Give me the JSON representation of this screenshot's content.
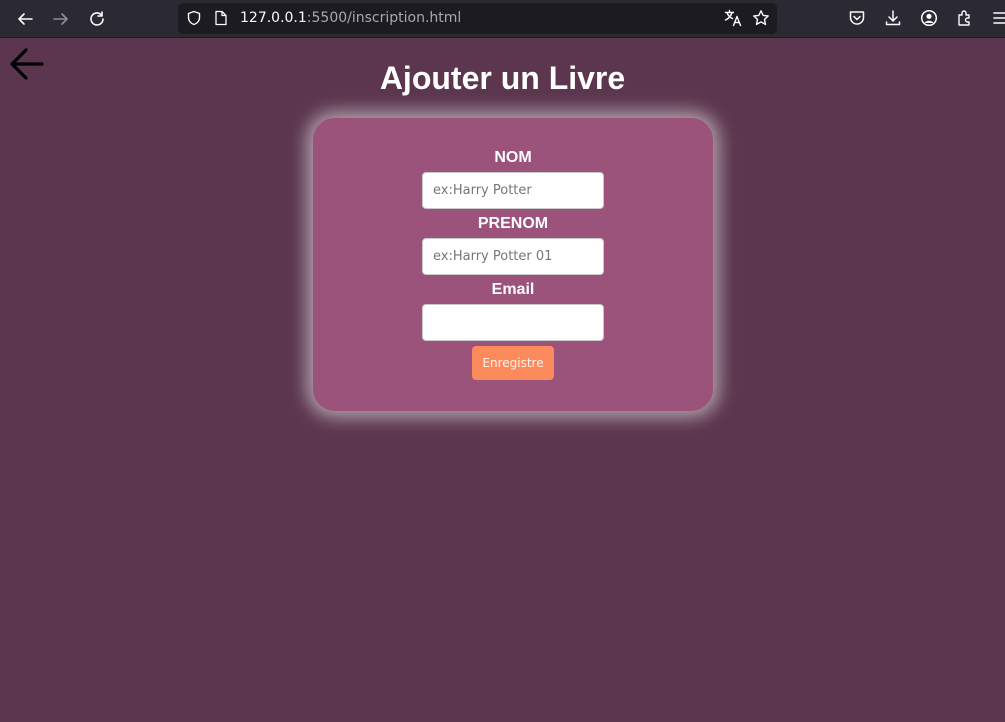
{
  "browser": {
    "url_host": "127.0.0.1",
    "url_rest": ":5500/inscription.html",
    "icons": [
      "back-icon",
      "forward-icon",
      "reload-icon",
      "shield-icon",
      "page-icon",
      "translate-icon",
      "star-icon",
      "pocket-icon",
      "download-icon",
      "account-icon",
      "extensions-icon",
      "menu-icon"
    ]
  },
  "page": {
    "title": "Ajouter un Livre",
    "back_icon": "arrow-left-icon"
  },
  "form": {
    "fields": [
      {
        "label": "NOM",
        "placeholder": "ex:Harry Potter",
        "value": ""
      },
      {
        "label": "PRENOM",
        "placeholder": "ex:Harry Potter 01",
        "value": ""
      },
      {
        "label": "Email",
        "placeholder": "",
        "value": ""
      }
    ],
    "submit_label": "Enregistre"
  },
  "colors": {
    "page_bg": "#5b364e",
    "card_bg": "#9b527b",
    "button_bg": "#fb8a5c",
    "chrome_bg": "#2b2a33"
  }
}
